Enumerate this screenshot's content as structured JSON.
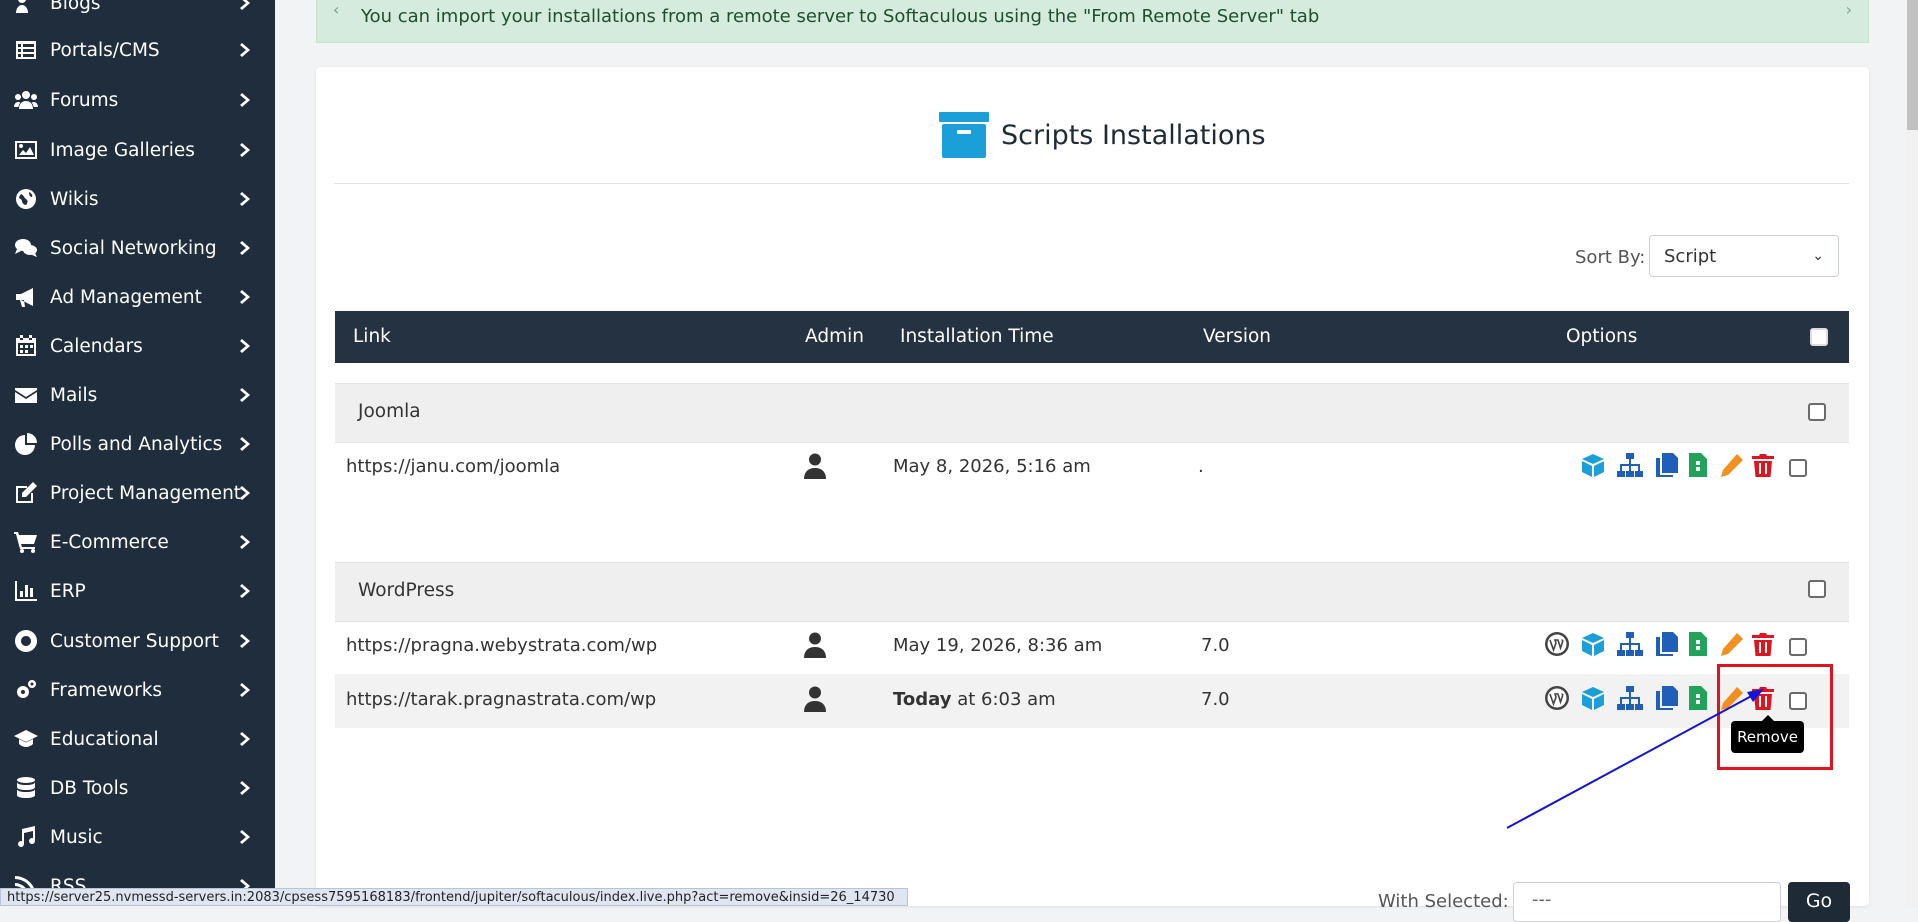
{
  "sidebar": {
    "items": [
      {
        "label": "Blogs",
        "icon": "blog-icon"
      },
      {
        "label": "Portals/CMS",
        "icon": "list-icon"
      },
      {
        "label": "Forums",
        "icon": "users-icon"
      },
      {
        "label": "Image Galleries",
        "icon": "image-icon"
      },
      {
        "label": "Wikis",
        "icon": "globe-icon"
      },
      {
        "label": "Social Networking",
        "icon": "comments-icon"
      },
      {
        "label": "Ad Management",
        "icon": "bullhorn-icon"
      },
      {
        "label": "Calendars",
        "icon": "calendar-icon"
      },
      {
        "label": "Mails",
        "icon": "envelope-icon"
      },
      {
        "label": "Polls and Analytics",
        "icon": "pie-chart-icon"
      },
      {
        "label": "Project Management",
        "icon": "edit-icon"
      },
      {
        "label": "E-Commerce",
        "icon": "cart-icon"
      },
      {
        "label": "ERP",
        "icon": "bar-chart-icon"
      },
      {
        "label": "Customer Support",
        "icon": "lifebuoy-icon"
      },
      {
        "label": "Frameworks",
        "icon": "gears-icon"
      },
      {
        "label": "Educational",
        "icon": "graduation-cap-icon"
      },
      {
        "label": "DB Tools",
        "icon": "database-icon"
      },
      {
        "label": "Music",
        "icon": "music-icon"
      },
      {
        "label": "RSS",
        "icon": "rss-icon"
      }
    ]
  },
  "alert": {
    "text": "You can import your installations from a remote server to Softaculous using the \"From Remote Server\" tab"
  },
  "page": {
    "title": "Scripts Installations",
    "icon": "archive-box-icon",
    "accent": "#1a9fd9"
  },
  "sort": {
    "label": "Sort By:",
    "value": "Script"
  },
  "table": {
    "headers": {
      "link": "Link",
      "admin": "Admin",
      "time": "Installation Time",
      "version": "Version",
      "options": "Options"
    },
    "groups": [
      {
        "name": "Joomla",
        "rows": [
          {
            "link": "https://janu.com/joomla",
            "time_bold": "",
            "time": "May 8, 2026, 5:16 am",
            "version": ".",
            "wp": false
          }
        ]
      },
      {
        "name": "WordPress",
        "rows": [
          {
            "link": "https://pragna.webystrata.com/wp",
            "time_bold": "",
            "time": "May 19, 2026, 8:36 am",
            "version": "7.0",
            "wp": true
          },
          {
            "link": "https://tarak.pragnastrata.com/wp",
            "time_bold": "Today",
            "time": "at 6:03 am",
            "version": "7.0",
            "wp": true
          }
        ]
      }
    ]
  },
  "tooltip": {
    "text": "Remove"
  },
  "bulk": {
    "label": "With Selected:",
    "value": "---",
    "go": "Go"
  },
  "status_url": "https://server25.nvmessd-servers.in:2083/cpsess7595168183/frontend/jupiter/softaculous/index.live.php?act=remove&insid=26_14730",
  "colors": {
    "sidebar": "#1f2d3d",
    "header": "#253241",
    "blue": "#1a9fd9",
    "navy": "#1f5fb8",
    "green": "#22a35a",
    "orange": "#f0901e",
    "red": "#e0141e"
  }
}
